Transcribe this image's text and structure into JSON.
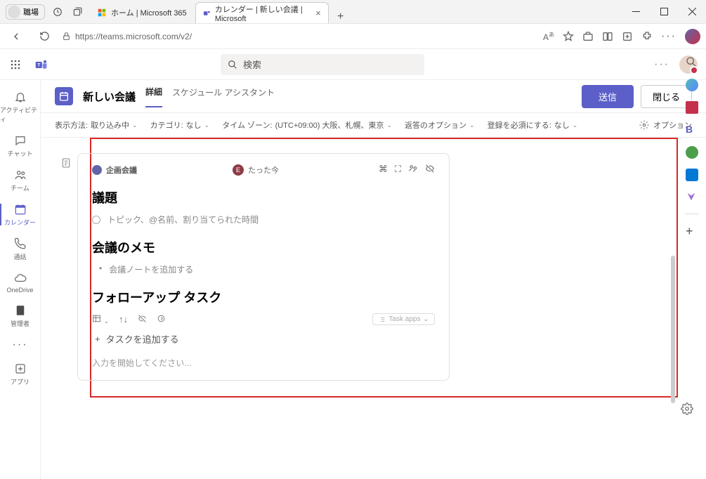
{
  "titlebar": {
    "profile_label": "職場",
    "tab1_label": "ホーム | Microsoft 365",
    "tab2_label": "カレンダー | 新しい会議 | Microsoft"
  },
  "address_bar": {
    "url": "https://teams.microsoft.com/v2/"
  },
  "search": {
    "placeholder": "検索"
  },
  "rail": {
    "activity": "アクティビティ",
    "chat": "チャット",
    "teams": "チーム",
    "calendar": "カレンダー",
    "calls": "通話",
    "onedrive": "OneDrive",
    "admin": "管理者",
    "apps": "アプリ"
  },
  "meeting": {
    "title": "新しい会議",
    "tab_details": "詳細",
    "tab_sched": "スケジュール アシスタント",
    "send": "送信",
    "close": "閉じる"
  },
  "options": {
    "display_label": "表示方法:",
    "display_value": "取り込み中",
    "category_label": "カテゴリ:",
    "category_value": "なし",
    "timezone_label": "タイム ゾーン:",
    "timezone_value": "(UTC+09:00) 大阪、札幌、東京",
    "response_label": "返答のオプション",
    "register_label": "登録を必須にする:",
    "register_value": "なし",
    "options_btn": "オプション"
  },
  "note": {
    "card_title": "企画会議",
    "avatar_initial": "E",
    "timestamp": "たった今",
    "section_agenda": "議題",
    "topic_placeholder": "トピック、@名前、割り当てられた時間",
    "section_notes": "会議のメモ",
    "notes_bullet": "会議ノートを追加する",
    "section_tasks": "フォローアップ タスク",
    "task_apps_label": "Task apps",
    "add_task": "タスクを追加する",
    "start_typing": "入力を開始してください..."
  }
}
